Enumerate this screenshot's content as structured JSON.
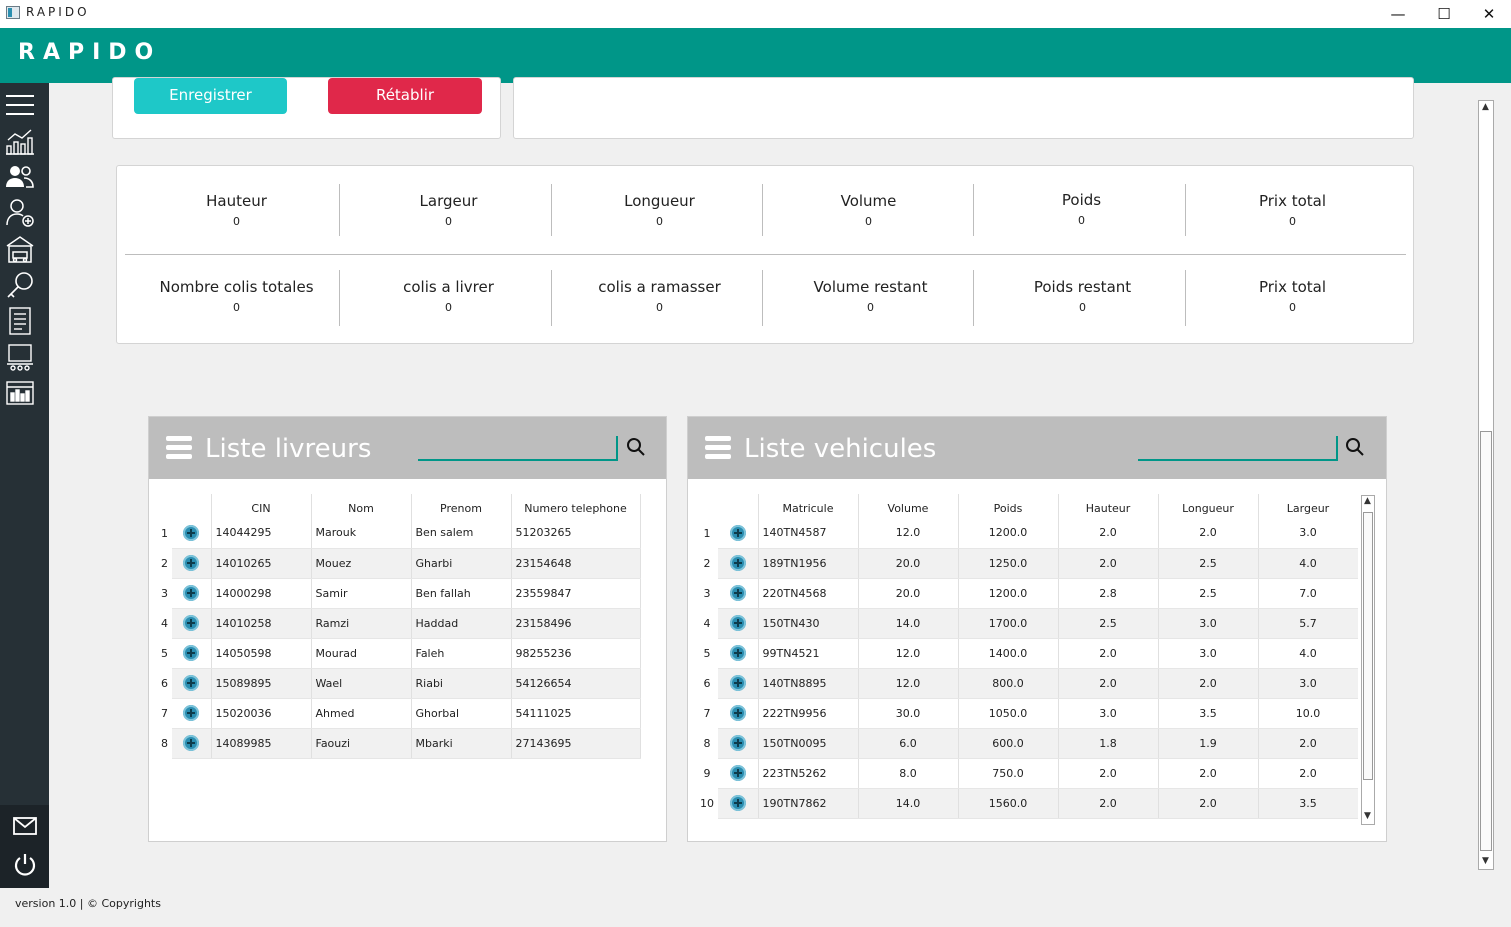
{
  "window": {
    "title": "RAPIDO",
    "minimize": "—",
    "maximize": "☐",
    "close": "✕"
  },
  "appbar": {
    "brand": "RAPIDO"
  },
  "sidebar": {
    "items": [
      "menu-icon",
      "statistics-icon",
      "users-icon",
      "add-user-icon",
      "garage-icon",
      "search-key-icon",
      "list-icon",
      "vehicle-monitor-icon",
      "dashboard-icon"
    ],
    "bottom": [
      "mail-icon",
      "power-icon"
    ]
  },
  "form": {
    "save_label": "Enregistrer",
    "reset_label": "Rétablir"
  },
  "stats": {
    "row1": [
      {
        "label": "Hauteur",
        "value": "0"
      },
      {
        "label": "Largeur",
        "value": "0"
      },
      {
        "label": "Longueur",
        "value": "0"
      },
      {
        "label": "Volume",
        "value": "0"
      },
      {
        "label": "Poids",
        "value": "0"
      },
      {
        "label": "Prix total",
        "value": "0"
      }
    ],
    "row2": [
      {
        "label": "Nombre colis totales",
        "value": "0"
      },
      {
        "label": "colis a livrer",
        "value": "0"
      },
      {
        "label": "colis a ramasser",
        "value": "0"
      },
      {
        "label": "Volume restant",
        "value": "0"
      },
      {
        "label": "Poids restant",
        "value": "0"
      },
      {
        "label": "Prix total",
        "value": "0"
      }
    ]
  },
  "livreurs": {
    "title": "Liste livreurs",
    "search_value": "",
    "columns": [
      "",
      "CIN",
      "Nom",
      "Prenom",
      "Numero telephone"
    ],
    "rows": [
      [
        "14044295",
        "Marouk",
        "Ben salem",
        "51203265"
      ],
      [
        "14010265",
        "Mouez",
        "Gharbi",
        "23154648"
      ],
      [
        "14000298",
        "Samir",
        "Ben fallah",
        "23559847"
      ],
      [
        "14010258",
        "Ramzi",
        "Haddad",
        "23158496"
      ],
      [
        "14050598",
        "Mourad",
        "Faleh",
        "98255236"
      ],
      [
        "15089895",
        "Wael",
        "Riabi",
        "54126654"
      ],
      [
        "15020036",
        "Ahmed",
        "Ghorbal",
        "54111025"
      ],
      [
        "14089985",
        "Faouzi",
        "Mbarki",
        "27143695"
      ]
    ]
  },
  "vehicules": {
    "title": "Liste vehicules",
    "search_value": "",
    "columns": [
      "",
      "Matricule",
      "Volume",
      "Poids",
      "Hauteur",
      "Longueur",
      "Largeur"
    ],
    "rows": [
      [
        "140TN4587",
        "12.0",
        "1200.0",
        "2.0",
        "2.0",
        "3.0"
      ],
      [
        "189TN1956",
        "20.0",
        "1250.0",
        "2.0",
        "2.5",
        "4.0"
      ],
      [
        "220TN4568",
        "20.0",
        "1200.0",
        "2.8",
        "2.5",
        "7.0"
      ],
      [
        "150TN430",
        "14.0",
        "1700.0",
        "2.5",
        "3.0",
        "5.7"
      ],
      [
        "99TN4521",
        "12.0",
        "1400.0",
        "2.0",
        "3.0",
        "4.0"
      ],
      [
        "140TN8895",
        "12.0",
        "800.0",
        "2.0",
        "2.0",
        "3.0"
      ],
      [
        "222TN9956",
        "30.0",
        "1050.0",
        "3.0",
        "3.5",
        "10.0"
      ],
      [
        "150TN0095",
        "6.0",
        "600.0",
        "1.8",
        "1.9",
        "2.0"
      ],
      [
        "223TN5262",
        "8.0",
        "750.0",
        "2.0",
        "2.0",
        "2.0"
      ],
      [
        "190TN7862",
        "14.0",
        "1560.0",
        "2.0",
        "2.0",
        "3.5"
      ]
    ]
  },
  "statusbar": {
    "text": "version 1.0 | © Copyrights"
  },
  "colors": {
    "accent": "#009688",
    "save": "#1ec8c8",
    "reset": "#e0284a",
    "sidebar": "#263036"
  }
}
